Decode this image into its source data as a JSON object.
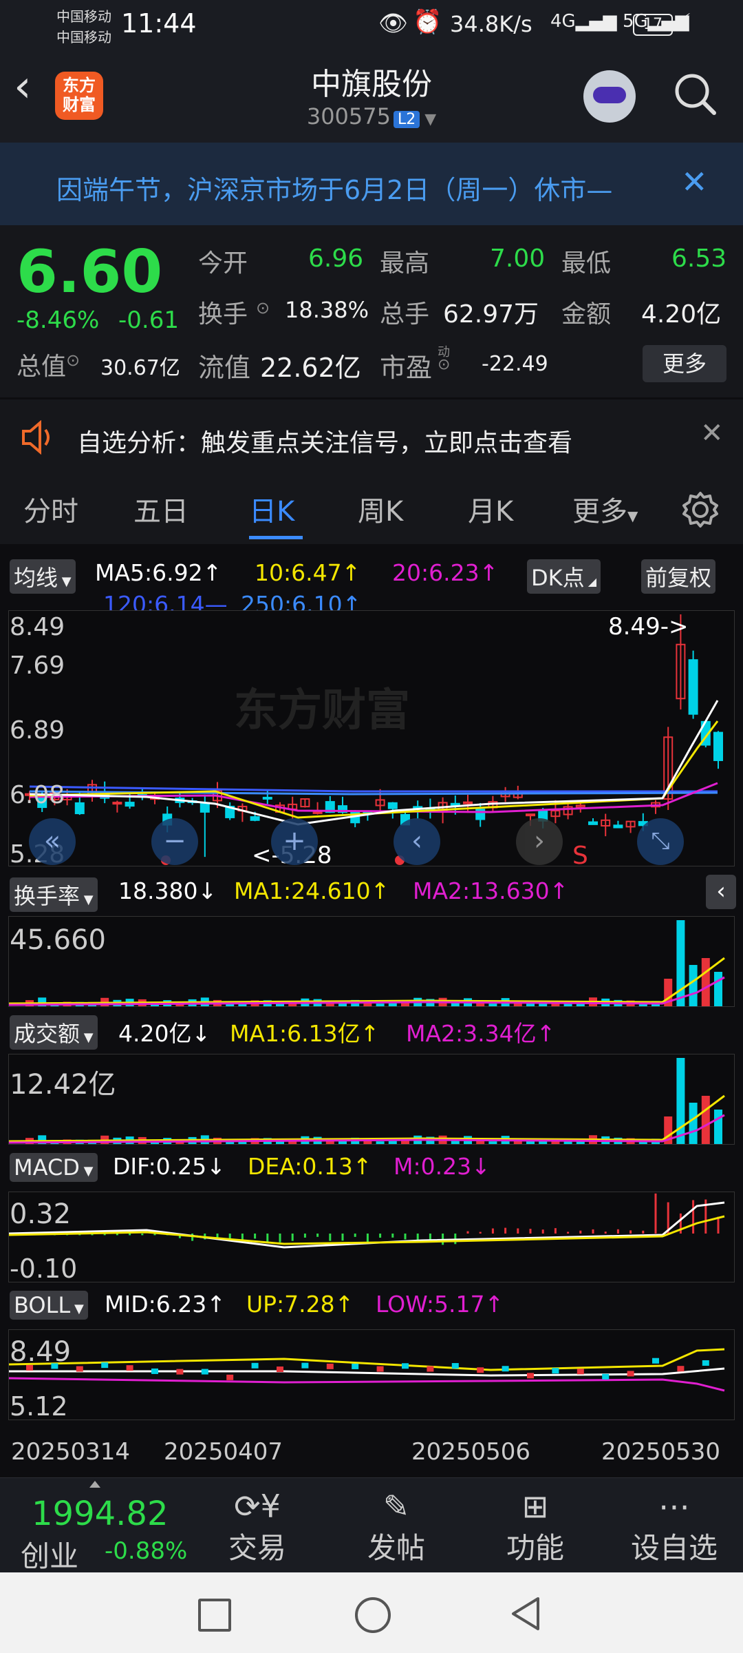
{
  "status_bar": {
    "carrier1": "中国移动",
    "carrier2": "中国移动",
    "time": "11:44",
    "net_speed": "34.8K/s",
    "battery": "17"
  },
  "header": {
    "logo_text": "东方财富",
    "stock_name": "中旗股份",
    "stock_code": "300575",
    "level_badge": "L2"
  },
  "notice": {
    "text": "因端午节，沪深京市场于6月2日（周一）休市—"
  },
  "quote": {
    "price": "6.60",
    "change_pct": "-8.46%",
    "change": "-0.61",
    "total_value_label": "总值",
    "total_value": "30.67亿",
    "open_label": "今开",
    "open": "6.96",
    "high_label": "最高",
    "high": "7.00",
    "low_label": "最低",
    "low": "6.53",
    "turnover_label": "换手",
    "turnover": "18.38%",
    "volume_label": "总手",
    "volume": "62.97万",
    "amount_label": "金额",
    "amount": "4.20亿",
    "float_label": "流值",
    "float_value": "22.62亿",
    "pe_label": "市盈",
    "pe_sup": "动",
    "pe": "-22.49",
    "more_button": "更多"
  },
  "alert": {
    "text": "自选分析：触发重点关注信号，立即点击查看"
  },
  "tabs": [
    "分时",
    "五日",
    "日K",
    "周K",
    "月K",
    "更多"
  ],
  "active_tab": "日K",
  "ma_bar": {
    "dropdown": "均线",
    "ma5": "MA5:6.92↑",
    "ma10": "10:6.47↑",
    "ma20": "20:6.23↑",
    "ma120": "120:6.14—",
    "ma250": "250:6.10↑",
    "dk_button": "DK点",
    "fq_button": "前复权"
  },
  "kline": {
    "y_top": "8.49",
    "y_2": "7.69",
    "y_3": "6.89",
    "y_4": "6.08",
    "y_bottom": "5.28",
    "max_label": "8.49->",
    "min_label": "<-5.28",
    "signal_s": "S",
    "watermark": "东方财富"
  },
  "turnover_ind": {
    "dropdown": "换手率",
    "value": "18.380↓",
    "ma1": "MA1:24.610↑",
    "ma2": "MA2:13.630↑",
    "y_top": "45.660"
  },
  "volume_ind": {
    "dropdown": "成交额",
    "value": "4.20亿↓",
    "ma1": "MA1:6.13亿↑",
    "ma2": "MA2:3.34亿↑",
    "y_top": "12.42亿"
  },
  "macd_ind": {
    "dropdown": "MACD",
    "dif": "DIF:0.25↓",
    "dea": "DEA:0.13↑",
    "m": "M:0.23↓",
    "y_top": "0.32",
    "y_bottom": "-0.10"
  },
  "boll_ind": {
    "dropdown": "BOLL",
    "mid": "MID:6.23↑",
    "up": "UP:7.28↑",
    "low": "LOW:5.17↑",
    "y_top": "8.49",
    "y_bottom": "5.12"
  },
  "x_dates": [
    "20250314",
    "20250407",
    "20250506",
    "20250530"
  ],
  "bottom_bar": {
    "index_value": "1994.82",
    "index_name": "创业",
    "index_change": "-0.88%",
    "items": [
      "交易",
      "发帖",
      "功能",
      "设自选"
    ]
  },
  "colors": {
    "up": "#e8333a",
    "down": "#00d2e6",
    "ma5": "#ffffff",
    "ma10": "#f3e600",
    "ma20": "#e01fd0",
    "ma120": "#3b5bff",
    "ma250": "#3b8bff",
    "accent": "#3b8bff"
  }
}
